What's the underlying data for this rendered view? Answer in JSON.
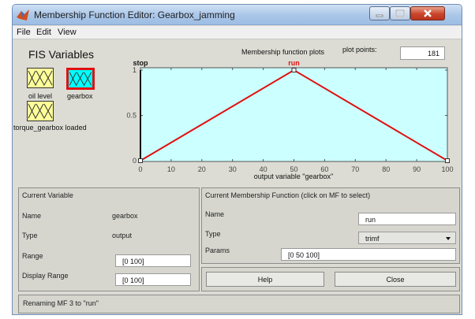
{
  "window": {
    "title": "Membership Function Editor: Gearbox_jamming"
  },
  "menu": [
    "File",
    "Edit",
    "View"
  ],
  "fis_variables": {
    "heading": "FIS Variables",
    "inputs": [
      {
        "label": "oil level",
        "selected": false
      },
      {
        "label": "gearbox",
        "selected": true
      },
      {
        "label": "torque_gearbox loaded",
        "selected": false
      }
    ]
  },
  "plot_header": {
    "title": "Membership function plots",
    "plot_points_label": "plot points:",
    "plot_points_value": "181"
  },
  "chart_data": {
    "type": "line",
    "xlabel": "output variable \"gearbox\"",
    "xlim": [
      0,
      100
    ],
    "ylim": [
      0,
      1
    ],
    "x_ticks": [
      "0",
      "10",
      "20",
      "30",
      "40",
      "50",
      "60",
      "70",
      "80",
      "90",
      "100"
    ],
    "y_ticks": [
      "0",
      "0.5",
      "1"
    ],
    "series": [
      {
        "name": "stop",
        "x": [
          0,
          0
        ],
        "y": [
          0,
          1
        ]
      },
      {
        "name": "run",
        "x": [
          0,
          50,
          100
        ],
        "y": [
          0,
          1,
          0
        ],
        "color": "#e01010"
      }
    ],
    "background": "#ccffff",
    "grid": false
  },
  "current_variable": {
    "heading": "Current Variable",
    "name_label": "Name",
    "name_value": "gearbox",
    "type_label": "Type",
    "type_value": "output",
    "range_label": "Range",
    "range_value": "[0 100]",
    "display_range_label": "Display Range",
    "display_range_value": "[0 100]"
  },
  "current_mf": {
    "heading": "Current Membership Function (click on MF to select)",
    "name_label": "Name",
    "name_value": "run",
    "type_label": "Type",
    "type_value": "trimf",
    "params_label": "Params",
    "params_value": "[0 50 100]"
  },
  "buttons": {
    "help": "Help",
    "close": "Close"
  },
  "status": "Renaming MF 3 to \"run\"",
  "colors": {
    "plot_bg": "#ccffff",
    "mf_line": "#e01010",
    "var_box": "#ffff99",
    "selected_box": "#00ffff",
    "selected_border": "#e01010"
  }
}
